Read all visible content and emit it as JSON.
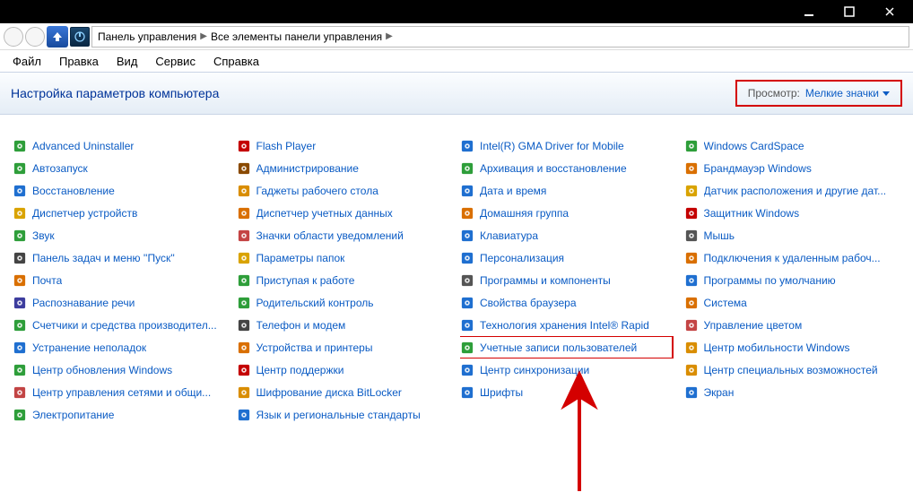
{
  "menu": {
    "file": "Файл",
    "edit": "Правка",
    "view": "Вид",
    "tools": "Сервис",
    "help": "Справка"
  },
  "breadcrumb": {
    "lvl1": "Панель управления",
    "lvl2": "Все элементы панели управления"
  },
  "header_title": "Настройка параметров компьютера",
  "view_label": "Просмотр:",
  "view_value": "Мелкие значки",
  "items": {
    "c1": [
      "Advanced Uninstaller",
      "Автозапуск",
      "Восстановление",
      "Диспетчер устройств",
      "Звук",
      "Панель задач и меню ''Пуск''",
      "Почта",
      "Распознавание речи",
      "Счетчики и средства производител...",
      "Устранение неполадок",
      "Центр обновления Windows",
      "Центр управления сетями и общи...",
      "Электропитание"
    ],
    "c2": [
      "Flash Player",
      "Администрирование",
      "Гаджеты рабочего стола",
      "Диспетчер учетных данных",
      "Значки области уведомлений",
      "Параметры папок",
      "Приступая к работе",
      "Родительский контроль",
      "Телефон и модем",
      "Устройства и принтеры",
      "Центр поддержки",
      "Шифрование диска BitLocker",
      "Язык и региональные стандарты"
    ],
    "c3": [
      "Intel(R) GMA Driver for Mobile",
      "Архивация и восстановление",
      "Дата и время",
      "Домашняя группа",
      "Клавиатура",
      "Персонализация",
      "Программы и компоненты",
      "Свойства браузера",
      "Технология хранения Intel® Rapid",
      "Учетные записи пользователей",
      "Центр синхронизации",
      "Шрифты"
    ],
    "c4": [
      "Windows CardSpace",
      "Брандмауэр Windows",
      "Датчик расположения и другие дат...",
      "Защитник Windows",
      "Мышь",
      "Подключения к удаленным рабоч...",
      "Программы по умолчанию",
      "Система",
      "Управление цветом",
      "Центр мобильности Windows",
      "Центр специальных возможностей",
      "Экран"
    ]
  },
  "icon_colors": {
    "c1": [
      "#2e9e3a",
      "#2e9e3a",
      "#1f6fd0",
      "#d9a300",
      "#2e9e3a",
      "#444444",
      "#d96f00",
      "#3d3d9e",
      "#2e9e3a",
      "#1f6fd0",
      "#2e9e3a",
      "#c24444",
      "#2e9e3a"
    ],
    "c2": [
      "#c40000",
      "#8a4a00",
      "#d98d00",
      "#d96f00",
      "#c44444",
      "#d9a300",
      "#2e9e3a",
      "#2e9e3a",
      "#444444",
      "#d96f00",
      "#c40000",
      "#d98d00",
      "#1f6fd0"
    ],
    "c3": [
      "#1f6fd0",
      "#2e9e3a",
      "#1f6fd0",
      "#d96f00",
      "#1f6fd0",
      "#1f6fd0",
      "#555555",
      "#1f6fd0",
      "#1f6fd0",
      "#2e9e3a",
      "#1f6fd0",
      "#1f6fd0"
    ],
    "c4": [
      "#2e9e3a",
      "#d96f00",
      "#d9a300",
      "#c40000",
      "#555555",
      "#d96f00",
      "#1f6fd0",
      "#d96f00",
      "#c44444",
      "#d98d00",
      "#d98d00",
      "#1f6fd0"
    ]
  },
  "highlight_key": "c3.9"
}
